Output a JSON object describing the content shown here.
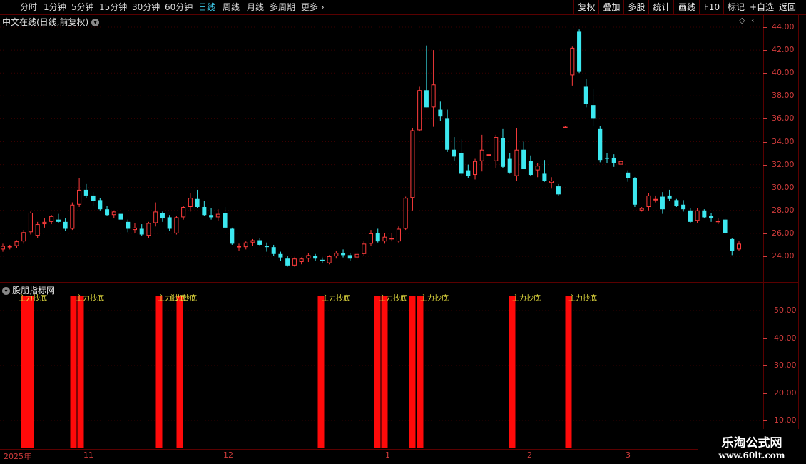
{
  "toolbar": {
    "periods": [
      "分时",
      "1分钟",
      "5分钟",
      "15分钟",
      "30分钟",
      "60分钟",
      "日线",
      "周线",
      "月线",
      "多周期",
      "更多"
    ],
    "active_period": "日线",
    "right_buttons": [
      "复权",
      "叠加",
      "多股",
      "统计",
      "画线",
      "F10",
      "标记",
      "+自选",
      "返回"
    ]
  },
  "main_panel": {
    "title": "中文在线(日线,前复权)"
  },
  "indicator_panel": {
    "title": "股朋指标网",
    "signal_label": "主力抄底"
  },
  "watermark": {
    "line1": "乐淘公式网",
    "line2": "www.60lt.com"
  },
  "chart_data": [
    {
      "type": "candlestick",
      "title": "中文在线(日线,前复权)",
      "ylim": [
        23,
        44.5
      ],
      "yticks": [
        "44.00",
        "42.00",
        "40.00",
        "38.00",
        "36.00",
        "34.00",
        "32.00",
        "30.00",
        "28.00",
        "26.00",
        "24.00"
      ],
      "x_labels": [
        "2025年",
        "11",
        "12",
        "1",
        "2",
        "3"
      ],
      "up_color": "#ff3c3c",
      "down_color": "#3ce8f0",
      "candles": [
        [
          24.6,
          25.1,
          24.4,
          24.9
        ],
        [
          24.8,
          25.0,
          24.6,
          24.9
        ],
        [
          24.9,
          25.4,
          24.7,
          25.3
        ],
        [
          25.3,
          26.3,
          25.1,
          26.1
        ],
        [
          26.1,
          27.9,
          25.9,
          27.8
        ],
        [
          25.8,
          27.0,
          25.6,
          26.8
        ],
        [
          26.8,
          27.3,
          26.5,
          27.0
        ],
        [
          27.0,
          27.6,
          26.8,
          27.5
        ],
        [
          27.2,
          27.7,
          26.9,
          27.0
        ],
        [
          27.0,
          27.3,
          26.2,
          26.4
        ],
        [
          26.4,
          28.7,
          26.3,
          28.5
        ],
        [
          28.5,
          30.8,
          28.3,
          29.8
        ],
        [
          29.8,
          30.3,
          29.1,
          29.3
        ],
        [
          29.3,
          29.6,
          28.4,
          28.8
        ],
        [
          28.9,
          29.1,
          28.0,
          28.1
        ],
        [
          28.1,
          28.4,
          27.5,
          27.6
        ],
        [
          27.6,
          28.0,
          27.3,
          27.9
        ],
        [
          27.7,
          27.9,
          27.0,
          27.2
        ],
        [
          27.0,
          27.2,
          26.1,
          26.4
        ],
        [
          26.3,
          26.9,
          26.0,
          26.5
        ],
        [
          26.4,
          26.8,
          25.8,
          25.9
        ],
        [
          25.8,
          27.0,
          25.6,
          26.9
        ],
        [
          26.9,
          28.7,
          26.6,
          27.9
        ],
        [
          27.8,
          27.9,
          27.0,
          27.3
        ],
        [
          27.4,
          27.6,
          26.2,
          26.4
        ],
        [
          26.0,
          27.5,
          25.9,
          27.4
        ],
        [
          27.4,
          28.4,
          27.2,
          28.3
        ],
        [
          28.3,
          29.5,
          27.9,
          29.1
        ],
        [
          29.0,
          29.8,
          28.2,
          28.3
        ],
        [
          28.3,
          28.8,
          27.5,
          27.6
        ],
        [
          27.6,
          28.2,
          27.2,
          27.4
        ],
        [
          27.4,
          28.1,
          27.1,
          27.7
        ],
        [
          27.8,
          28.3,
          26.4,
          26.5
        ],
        [
          26.4,
          26.5,
          25.0,
          25.1
        ],
        [
          24.8,
          25.1,
          24.5,
          24.9
        ],
        [
          24.8,
          25.3,
          24.6,
          25.2
        ],
        [
          25.2,
          25.5,
          24.9,
          25.4
        ],
        [
          25.4,
          25.6,
          24.9,
          25.0
        ],
        [
          24.9,
          25.2,
          24.4,
          24.8
        ],
        [
          24.8,
          25.0,
          24.0,
          24.2
        ],
        [
          24.2,
          24.4,
          23.6,
          23.9
        ],
        [
          23.8,
          24.0,
          23.1,
          23.2
        ],
        [
          23.2,
          23.9,
          23.1,
          23.8
        ],
        [
          23.5,
          23.9,
          23.3,
          23.8
        ],
        [
          23.8,
          24.3,
          23.5,
          24.1
        ],
        [
          24.0,
          24.2,
          23.6,
          23.8
        ],
        [
          23.7,
          23.9,
          23.4,
          23.6
        ],
        [
          23.4,
          24.1,
          23.3,
          24.0
        ],
        [
          24.0,
          24.5,
          23.8,
          24.3
        ],
        [
          24.3,
          24.6,
          23.9,
          24.1
        ],
        [
          24.1,
          24.3,
          23.6,
          23.8
        ],
        [
          23.9,
          24.4,
          23.7,
          24.2
        ],
        [
          24.2,
          25.3,
          24.0,
          25.1
        ],
        [
          25.1,
          26.3,
          24.9,
          26.0
        ],
        [
          26.0,
          26.4,
          25.2,
          25.3
        ],
        [
          25.3,
          26.0,
          25.1,
          25.7
        ],
        [
          25.5,
          26.0,
          25.3,
          25.6
        ],
        [
          25.3,
          26.6,
          25.2,
          26.4
        ],
        [
          26.4,
          29.2,
          26.3,
          29.1
        ],
        [
          29.1,
          35.2,
          28.0,
          35.0
        ],
        [
          35.0,
          38.8,
          34.9,
          38.5
        ],
        [
          38.5,
          42.4,
          37.0,
          37.0
        ],
        [
          37.0,
          42.0,
          35.3,
          39.0
        ],
        [
          36.8,
          37.5,
          35.8,
          36.2
        ],
        [
          36.0,
          36.8,
          33.1,
          33.3
        ],
        [
          33.3,
          34.4,
          32.3,
          32.7
        ],
        [
          33.0,
          34.2,
          31.0,
          31.2
        ],
        [
          31.5,
          32.0,
          30.8,
          31.0
        ],
        [
          31.1,
          32.5,
          30.7,
          32.3
        ],
        [
          32.3,
          34.6,
          31.4,
          33.3
        ],
        [
          32.8,
          33.3,
          32.5,
          32.9
        ],
        [
          32.3,
          34.6,
          31.7,
          34.4
        ],
        [
          34.3,
          35.1,
          31.7,
          31.8
        ],
        [
          32.5,
          33.0,
          31.2,
          31.3
        ],
        [
          31.0,
          35.2,
          30.6,
          33.3
        ],
        [
          33.3,
          34.0,
          31.7,
          31.6
        ],
        [
          32.3,
          32.8,
          31.0,
          31.1
        ],
        [
          31.5,
          32.1,
          30.9,
          31.9
        ],
        [
          31.2,
          32.4,
          30.5,
          30.6
        ],
        [
          30.4,
          30.9,
          29.9,
          30.6
        ],
        [
          30.1,
          30.3,
          29.3,
          29.4
        ],
        [
          35.3,
          35.4,
          35.2,
          35.3
        ],
        [
          39.8,
          42.3,
          38.9,
          42.2
        ],
        [
          43.6,
          43.8,
          40.0,
          40.1
        ],
        [
          38.8,
          39.5,
          37.0,
          37.3
        ],
        [
          37.2,
          38.6,
          35.4,
          36.0
        ],
        [
          35.1,
          35.4,
          32.2,
          32.4
        ],
        [
          32.6,
          33.0,
          32.1,
          32.5
        ],
        [
          32.6,
          32.9,
          31.8,
          32.1
        ],
        [
          32.0,
          32.5,
          31.7,
          32.3
        ],
        [
          31.3,
          31.5,
          30.5,
          30.8
        ],
        [
          30.8,
          30.9,
          28.3,
          28.5
        ],
        [
          28.0,
          28.3,
          27.9,
          28.2
        ],
        [
          28.3,
          29.5,
          28.0,
          29.3
        ],
        [
          29.0,
          29.3,
          28.7,
          29.0
        ],
        [
          29.2,
          29.6,
          27.7,
          28.1
        ],
        [
          29.3,
          29.8,
          28.8,
          29.0
        ],
        [
          28.9,
          29.0,
          28.3,
          28.4
        ],
        [
          28.5,
          28.9,
          27.9,
          28.1
        ],
        [
          28.0,
          28.2,
          26.9,
          27.0
        ],
        [
          27.1,
          28.2,
          26.9,
          28.0
        ],
        [
          28.0,
          28.1,
          27.3,
          27.4
        ],
        [
          27.5,
          27.8,
          27.0,
          27.3
        ],
        [
          27.0,
          27.3,
          26.8,
          27.1
        ],
        [
          27.2,
          27.3,
          25.9,
          26.0
        ],
        [
          25.5,
          25.6,
          24.1,
          24.5
        ],
        [
          24.6,
          25.3,
          24.5,
          25.1
        ]
      ]
    },
    {
      "type": "bar",
      "title": "股朋指标网",
      "ylim": [
        0,
        58
      ],
      "yticks": [
        "50.00",
        "40.00",
        "30.00",
        "20.00",
        "10.00"
      ],
      "series": [
        {
          "values": [
            50,
            50,
            50,
            50,
            50,
            50,
            50,
            50,
            50,
            50,
            50,
            50,
            50,
            50
          ]
        }
      ]
    }
  ]
}
